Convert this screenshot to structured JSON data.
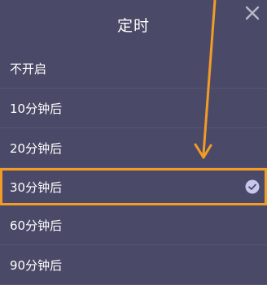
{
  "dialog": {
    "title": "定时",
    "options": [
      {
        "label": "不开启",
        "selected": false
      },
      {
        "label": "10分钟后",
        "selected": false
      },
      {
        "label": "20分钟后",
        "selected": false
      },
      {
        "label": "30分钟后",
        "selected": true
      },
      {
        "label": "60分钟后",
        "selected": false
      },
      {
        "label": "90分钟后",
        "selected": false
      }
    ]
  },
  "icons": {
    "close": "close-icon",
    "check": "check-circle-icon",
    "annotation": "arrow-annotation"
  },
  "colors": {
    "background": "#4a4a68",
    "highlight": "#f29b26",
    "check_fill": "#c9c6ef",
    "close": "#b8b8c8"
  }
}
